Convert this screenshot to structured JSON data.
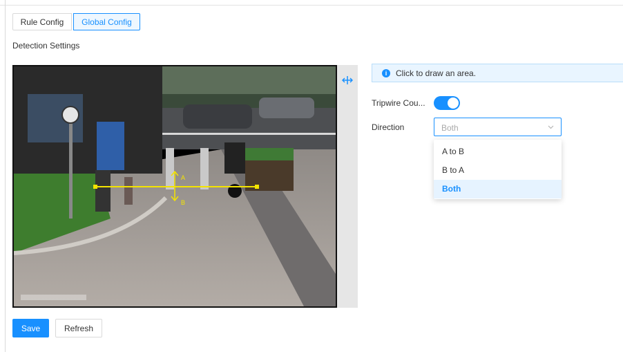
{
  "tabs": [
    {
      "label": "Rule Config",
      "active": false
    },
    {
      "label": "Global Config",
      "active": true
    }
  ],
  "section_title": "Detection Settings",
  "video": {
    "line_label_a": "A",
    "line_label_b": "B"
  },
  "info": {
    "text": "Click to draw an area.",
    "icon": "info-icon"
  },
  "form": {
    "tripwire_label": "Tripwire Cou...",
    "tripwire_enabled": true,
    "direction_label": "Direction",
    "direction_value": "Both",
    "direction_options": [
      "A to B",
      "B to A",
      "Both"
    ]
  },
  "buttons": {
    "save": "Save",
    "refresh": "Refresh"
  },
  "colors": {
    "accent": "#1890ff",
    "tripwire_line": "#f4e400"
  }
}
